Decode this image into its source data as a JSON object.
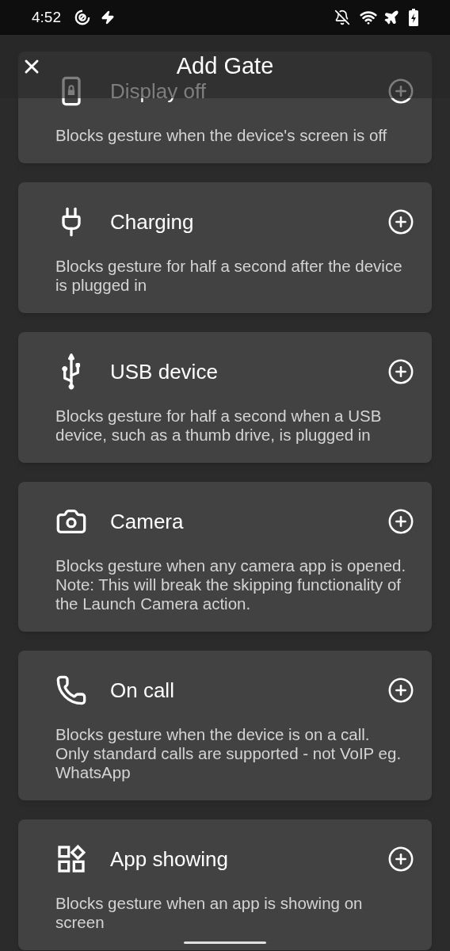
{
  "status_bar": {
    "time": "4:52"
  },
  "header": {
    "title": "Add Gate"
  },
  "gates": [
    {
      "kind": "display",
      "title": "Display off",
      "description": "Blocks gesture when the device's screen is off"
    },
    {
      "kind": "charging",
      "title": "Charging",
      "description": "Blocks gesture for half a second after the device is plugged in"
    },
    {
      "kind": "usb",
      "title": "USB device",
      "description": "Blocks gesture for half a second when a USB device, such as a thumb drive, is plugged in"
    },
    {
      "kind": "camera",
      "title": "Camera",
      "description": "Blocks gesture when any camera app is opened.\nNote: This will break the skipping functionality of the Launch Camera action."
    },
    {
      "kind": "call",
      "title": "On call",
      "description": "Blocks gesture when the device is on a call.\nOnly standard calls are supported - not VoIP eg. WhatsApp"
    },
    {
      "kind": "app",
      "title": "App showing",
      "description": "Blocks gesture when an app is showing on screen"
    }
  ]
}
